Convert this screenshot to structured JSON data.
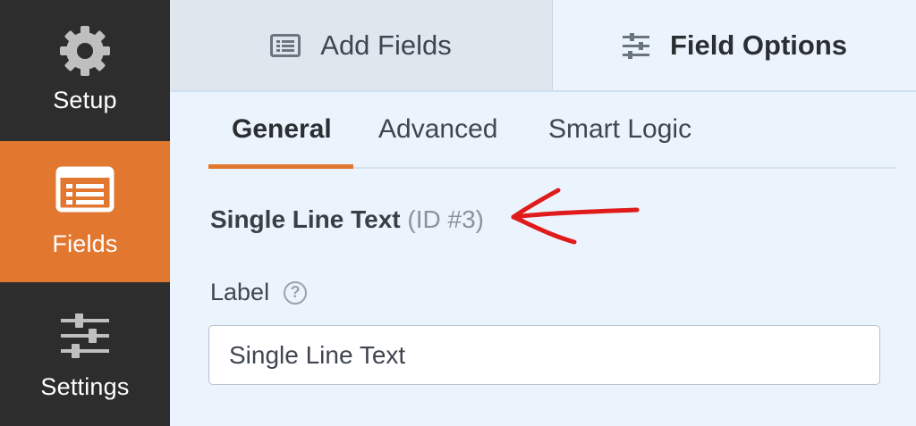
{
  "sidebar": {
    "items": [
      {
        "label": "Setup",
        "icon": "gear-icon",
        "active": false
      },
      {
        "label": "Fields",
        "icon": "list-form-icon",
        "active": true
      },
      {
        "label": "Settings",
        "icon": "sliders-icon",
        "active": false
      }
    ]
  },
  "top_tabs": [
    {
      "label": "Add Fields",
      "icon": "list-icon",
      "active": false
    },
    {
      "label": "Field Options",
      "icon": "sliders-icon",
      "active": true
    }
  ],
  "sub_tabs": [
    {
      "label": "General",
      "active": true
    },
    {
      "label": "Advanced",
      "active": false
    },
    {
      "label": "Smart Logic",
      "active": false
    }
  ],
  "field": {
    "type_name": "Single Line Text",
    "id_text": "(ID #3)",
    "label_caption": "Label",
    "help_symbol": "?",
    "label_value": "Single Line Text"
  },
  "colors": {
    "accent": "#e27730",
    "sidebar_bg": "#2d2d2d",
    "panel_bg": "#ebf3fc",
    "annotation_arrow": "#e01b1b"
  }
}
